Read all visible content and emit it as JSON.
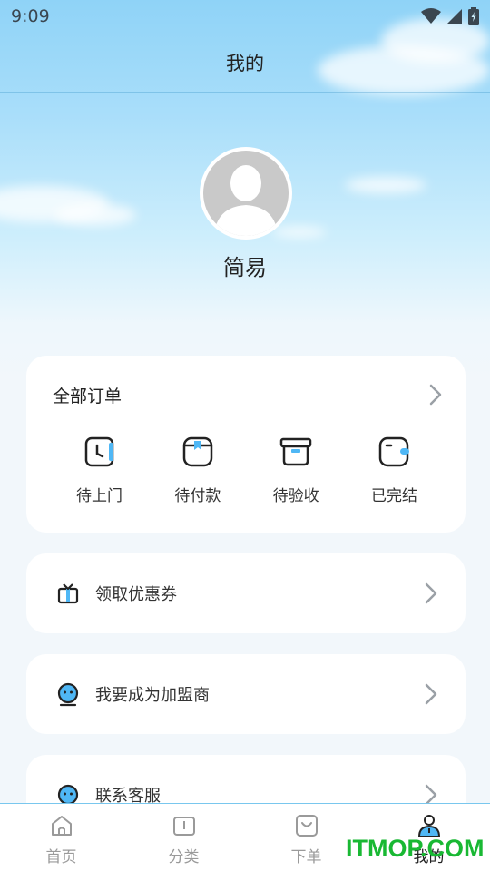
{
  "status_bar": {
    "time": "9:09"
  },
  "header": {
    "title": "我的"
  },
  "profile": {
    "username": "简易"
  },
  "orders": {
    "title": "全部订单",
    "items": [
      {
        "label": "待上门",
        "icon": "clock-box-icon"
      },
      {
        "label": "待付款",
        "icon": "wallet-box-icon"
      },
      {
        "label": "待验收",
        "icon": "package-box-icon"
      },
      {
        "label": "已完结",
        "icon": "done-box-icon"
      }
    ]
  },
  "menu": [
    {
      "label": "领取优惠券",
      "icon": "gift-icon"
    },
    {
      "label": "我要成为加盟商",
      "icon": "partner-face-icon"
    },
    {
      "label": "联系客服",
      "icon": "support-agent-icon"
    }
  ],
  "bottom_nav": [
    {
      "label": "首页",
      "icon": "home-icon",
      "active": false
    },
    {
      "label": "分类",
      "icon": "category-book-icon",
      "active": false
    },
    {
      "label": "下单",
      "icon": "shopping-bag-icon",
      "active": false
    },
    {
      "label": "我的",
      "icon": "profile-icon",
      "active": true
    }
  ],
  "watermark": "ITMOP.COM",
  "colors": {
    "accent_blue": "#4fb7f5",
    "sky_top": "#8fd3f7",
    "watermark_green": "#19b833",
    "icon_stroke": "#222222"
  }
}
